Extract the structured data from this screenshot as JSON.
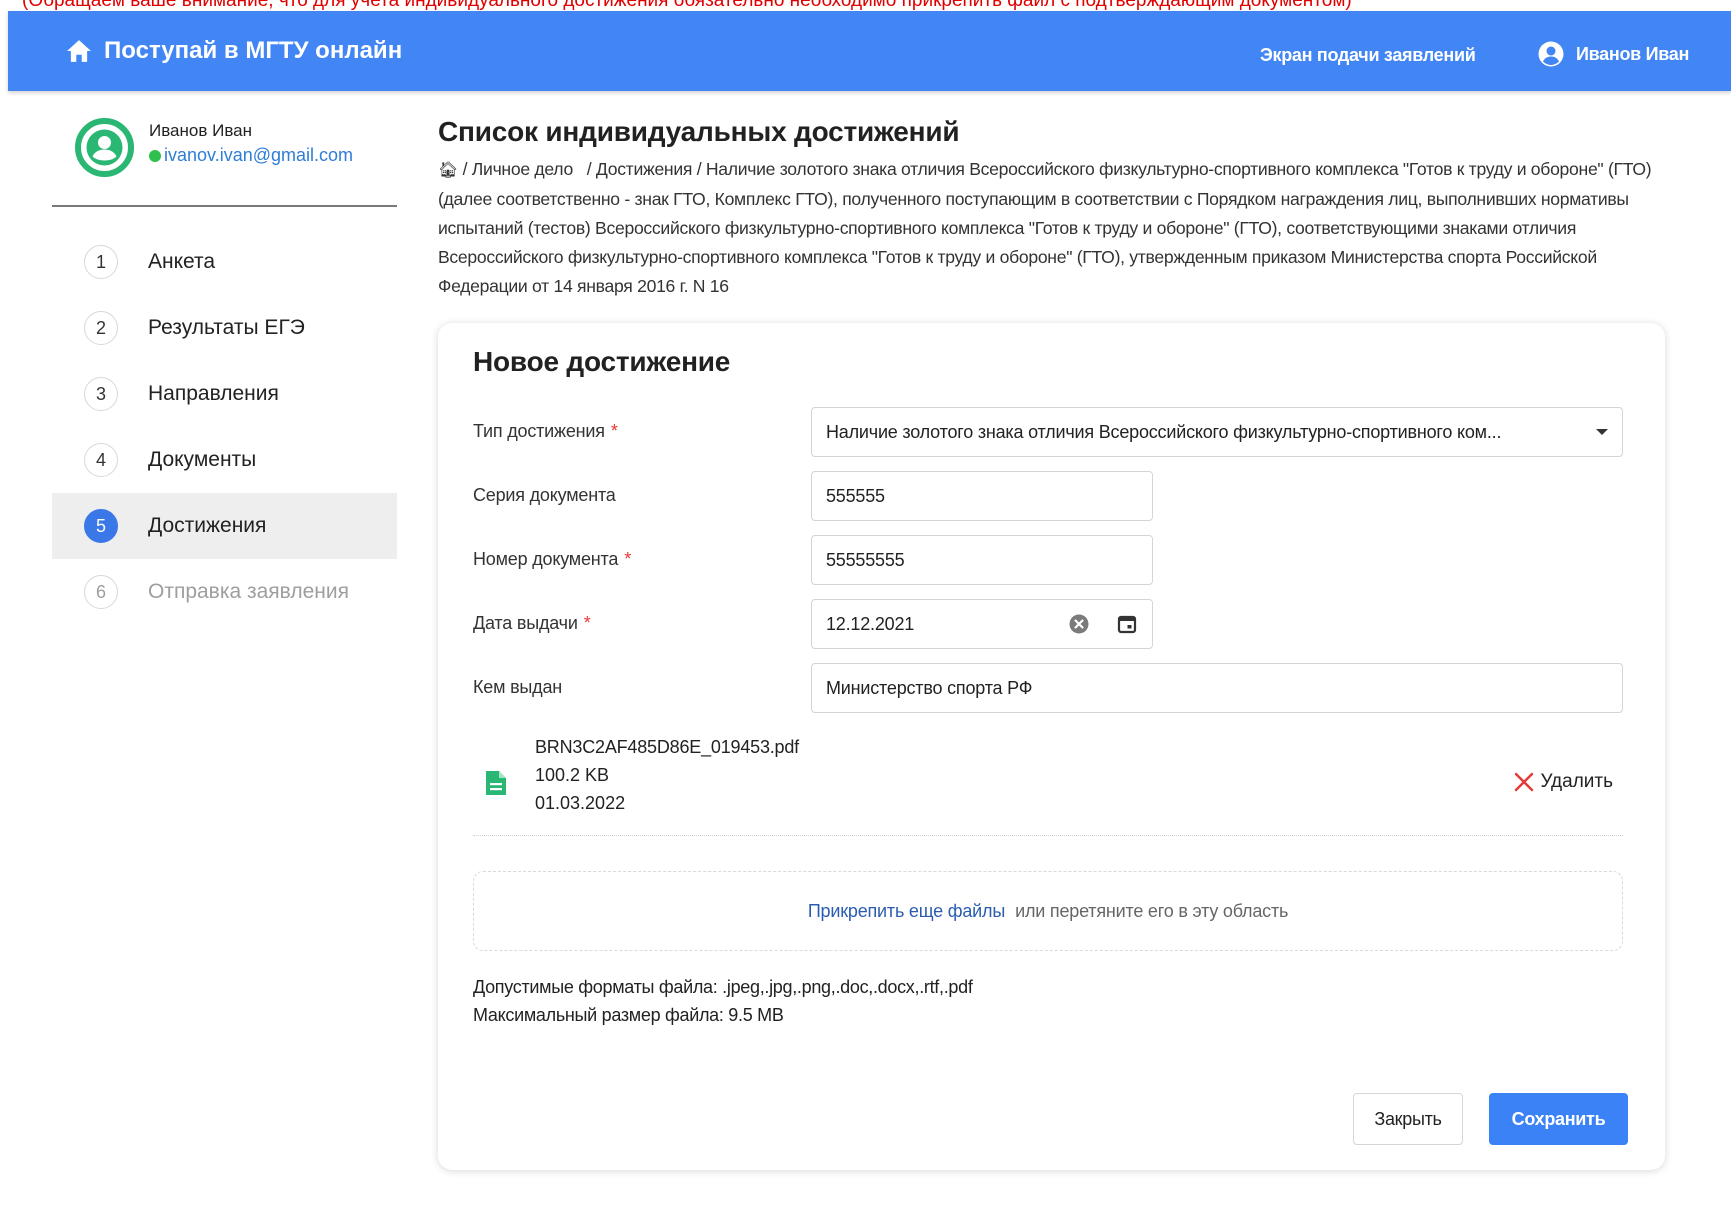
{
  "notice": "(Обращаем ваше внимание, что для учета индивидуального достижения обязательно необходимо прикрепить файл с подтверждающим документом)",
  "header": {
    "brand": "Поступай в МГТУ онлайн",
    "screen_link": "Экран подачи заявлений",
    "user_name": "Иванов Иван",
    "color": "#4285f4"
  },
  "profile": {
    "name": "Иванов Иван",
    "email": "ivanov.ivan@gmail.com",
    "status_color": "#2fbf4c",
    "avatar_color": "#2ab673"
  },
  "steps": [
    {
      "num": "1",
      "label": "Анкета",
      "state": "default"
    },
    {
      "num": "2",
      "label": "Результаты ЕГЭ",
      "state": "default"
    },
    {
      "num": "3",
      "label": "Направления",
      "state": "default"
    },
    {
      "num": "4",
      "label": "Документы",
      "state": "default"
    },
    {
      "num": "5",
      "label": "Достижения",
      "state": "active"
    },
    {
      "num": "6",
      "label": "Отправка заявления",
      "state": "disabled"
    }
  ],
  "page": {
    "title": "Список индивидуальных достижений",
    "breadcrumb": {
      "home_icon": "home-icon",
      "items": [
        "Личное дело",
        "Достижения",
        "Наличие золотого знака отличия Всероссийского физкультурно-спортивного комплекса \"Готов к труду и обороне\" (ГТО) (далее соответственно - знак ГТО, Комплекс ГТО), полученного поступающим в соответствии с Порядком награждения лиц, выполнивших нормативы испытаний (тестов) Всероссийского физкультурно-спортивного комплекса \"Готов к труду и обороне\" (ГТО), соответствующими знаками отличия Всероссийского физкультурно-спортивного комплекса \"Готов к труду и обороне\" (ГТО), утвержденным приказом Министерства спорта Российской Федерации от 14 января 2016 г. N 16"
      ]
    }
  },
  "form": {
    "title": "Новое достижение",
    "type_label": "Тип достижения",
    "type_value": "Наличие золотого знака отличия Всероссийского физкультурно-спортивного ком...",
    "series_label": "Серия документа",
    "series_value": "555555",
    "number_label": "Номер документа",
    "number_value": "55555555",
    "date_label": "Дата выдачи",
    "date_value": "12.12.2021",
    "issuer_label": "Кем выдан",
    "issuer_value": "Министерство спорта РФ",
    "required_mark": "*"
  },
  "file": {
    "name": "BRN3C2AF485D86E_019453.pdf",
    "size": "100.2 KB",
    "date": "01.03.2022",
    "delete_label": "Удалить",
    "icon": "file-document-icon",
    "icon_color": "#2ab673"
  },
  "dropzone": {
    "link": "Прикрепить еще файлы",
    "hint": "или перетяните его в эту область"
  },
  "formats": {
    "allowed": "Допустимые форматы файла: .jpeg,.jpg,.png,.doc,.docx,.rtf,.pdf",
    "max_size": "Максимальный размер файла: 9.5 MB"
  },
  "buttons": {
    "close": "Закрыть",
    "save": "Сохранить",
    "save_color": "#3b82f6"
  }
}
